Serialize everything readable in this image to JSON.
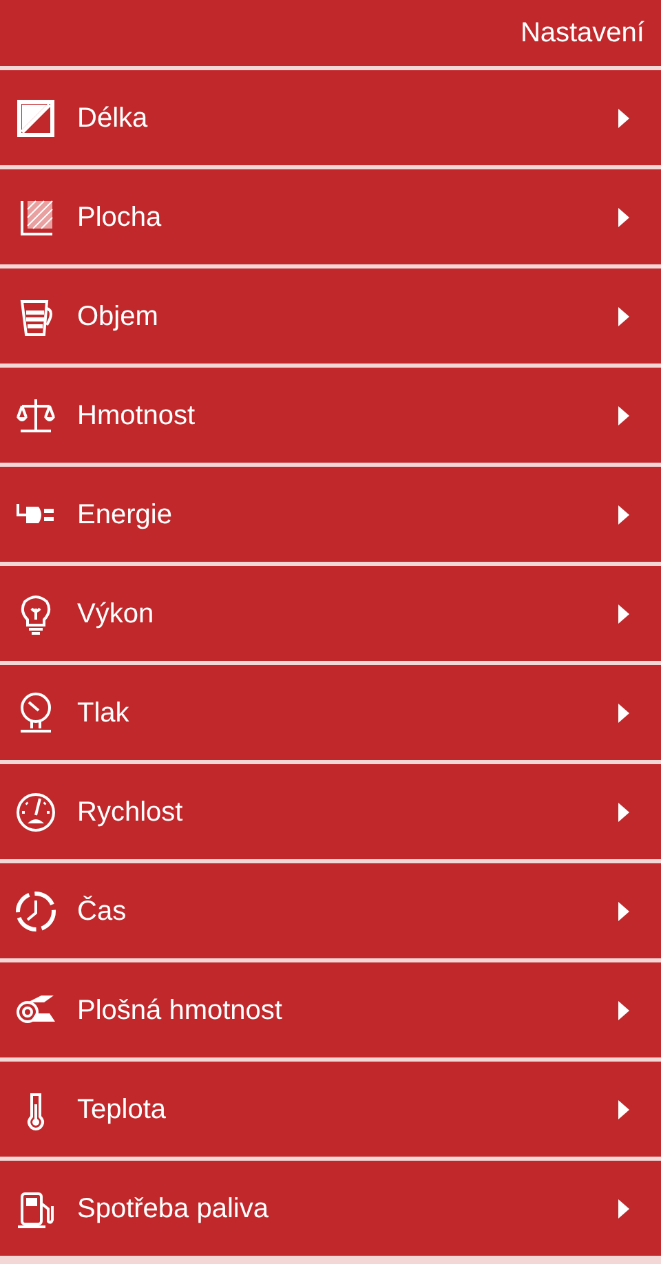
{
  "header": {
    "title": "Nastavení"
  },
  "items": [
    {
      "label": "Délka",
      "kind": "length"
    },
    {
      "label": "Plocha",
      "kind": "area"
    },
    {
      "label": "Objem",
      "kind": "volume"
    },
    {
      "label": "Hmotnost",
      "kind": "mass"
    },
    {
      "label": "Energie",
      "kind": "energy"
    },
    {
      "label": "Výkon",
      "kind": "power"
    },
    {
      "label": "Tlak",
      "kind": "pressure"
    },
    {
      "label": "Rychlost",
      "kind": "speed"
    },
    {
      "label": "Čas",
      "kind": "time"
    },
    {
      "label": "Plošná hmotnost",
      "kind": "areal"
    },
    {
      "label": "Teplota",
      "kind": "temperature"
    },
    {
      "label": "Spotřeba paliva",
      "kind": "fuel"
    }
  ]
}
